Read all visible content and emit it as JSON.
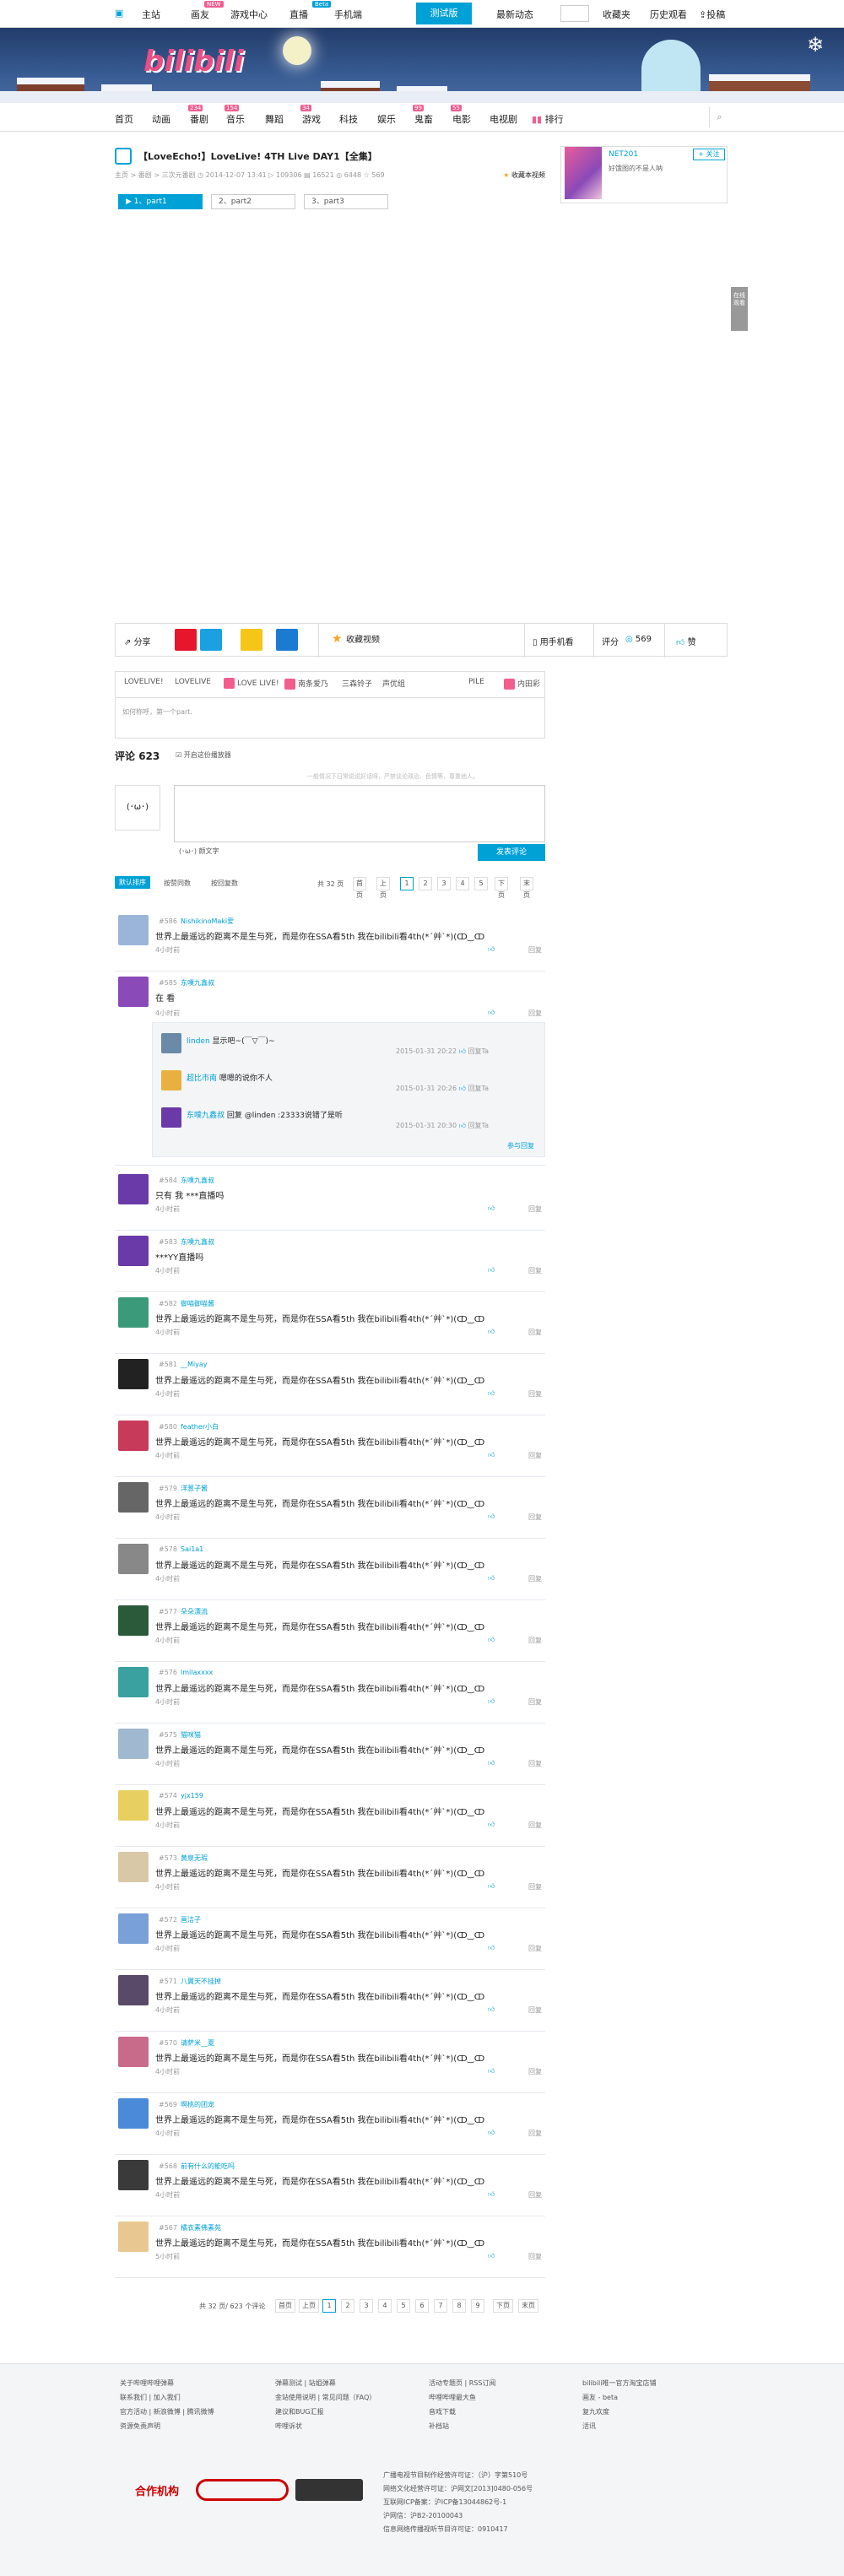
{
  "topbar": {
    "home": "主站",
    "circle": "画友",
    "circle_tag": "NEW",
    "game": "游戏中心",
    "live": "直播",
    "live_tag": "Beta",
    "mobile": "手机端",
    "beta": "测试版",
    "dynamic": "最新动态",
    "favorites": "收藏夹",
    "history": "历史观看",
    "upload": "投稿"
  },
  "nav": {
    "items": [
      {
        "label": "首页",
        "count": ""
      },
      {
        "label": "动画",
        "count": ""
      },
      {
        "label": "番剧",
        "count": "234"
      },
      {
        "label": "音乐",
        "count": "154"
      },
      {
        "label": "舞蹈",
        "count": ""
      },
      {
        "label": "游戏",
        "count": "34"
      },
      {
        "label": "科技",
        "count": ""
      },
      {
        "label": "娱乐",
        "count": ""
      },
      {
        "label": "鬼畜",
        "count": "99"
      },
      {
        "label": "电影",
        "count": "55"
      },
      {
        "label": "电视剧",
        "count": ""
      },
      {
        "label": "排行",
        "count": ""
      }
    ]
  },
  "video": {
    "title": "【LoveEcho!】LoveLive! 4TH Live DAY1【全集】",
    "breadcrumb": "主页 > 番剧 > 三次元番剧",
    "date": "2014-12-07 13:41",
    "plays": "109306",
    "danmaku": "16521",
    "coins": "6448",
    "favs": "569",
    "fav_label": "收藏本视频",
    "parts": [
      "1、part1",
      "2、part2",
      "3、part3"
    ]
  },
  "uploader": {
    "name": "NET201",
    "sign": "好饿图的不是人呐",
    "follow": "+ 关注"
  },
  "side_float": "在线观看",
  "actions": {
    "share": "分享",
    "collect": "收藏视频",
    "mobile": "用手机看",
    "score_label": "评分",
    "score": "569",
    "like": "赞"
  },
  "tags": [
    "LOVELIVE!",
    "LOVELIVE",
    "LOVE LIVE!",
    "南条爱乃",
    "三森铃子",
    "声优组",
    "PILE",
    "内田彩"
  ],
  "tag_hint": "如何称呼，第一个part.",
  "comments_header": {
    "title": "评论",
    "count": "623",
    "toggle": "开启这份播放器",
    "ad": "一般情况下日常说说好话呀，严禁谈论政治、色情等，尊重他人。"
  },
  "editor": {
    "avatar": "(･ω･)",
    "emoji": "(･ω･) 颜文字",
    "send": "发表评论"
  },
  "sort": {
    "default": "默认排序",
    "by_likes": "按赞同数",
    "by_replies": "按回复数",
    "total_pages": "共 32 页",
    "first": "首页",
    "prev": "上页",
    "pages": [
      "1",
      "2",
      "3",
      "4",
      "5"
    ],
    "next": "下页",
    "last": "末页"
  },
  "comments": [
    {
      "floor": "#586",
      "user": "NishikinoMaki爱",
      "text": "世界上最遥远的距离不是生与死，而是你在SSA看5th 我在bilibili看4th(*´艸`*)(ↀ‿ↀ",
      "time": "4小时前",
      "likes": "",
      "color": "#9bb5d8"
    },
    {
      "floor": "#585",
      "user": "东噗九鑫叔",
      "text": "在 看",
      "time": "4小时前",
      "likes": "",
      "color": "#8a4ab8"
    },
    {
      "floor": "#584",
      "user": "东噗九鑫叔",
      "text": "只有 我 ***直播吗",
      "time": "4小时前",
      "likes": "",
      "color": "#6a3aa8"
    },
    {
      "floor": "#583",
      "user": "东噗九鑫叔",
      "text": "***YY直播吗",
      "time": "4小时前",
      "likes": "",
      "color": "#6a3aa8"
    },
    {
      "floor": "#582",
      "user": "御喵御喵酱",
      "text": "世界上最遥远的距离不是生与死，而是你在SSA看5th 我在bilibili看4th(*´艸`*)(ↀ‿ↀ",
      "time": "4小时前",
      "likes": "",
      "color": "#3a9a7a"
    },
    {
      "floor": "#581",
      "user": "__Miyay",
      "text": "世界上最遥远的距离不是生与死，而是你在SSA看5th 我在bilibili看4th(*´艸`*)(ↀ‿ↀ",
      "time": "4小时前",
      "likes": "",
      "color": "#222"
    },
    {
      "floor": "#580",
      "user": "feather小白",
      "text": "世界上最遥远的距离不是生与死，而是你在SSA看5th 我在bilibili看4th(*´艸`*)(ↀ‿ↀ",
      "time": "4小时前",
      "likes": "",
      "color": "#c83a5a"
    },
    {
      "floor": "#579",
      "user": "洋葱子酱",
      "text": "世界上最遥远的距离不是生与死，而是你在SSA看5th 我在bilibili看4th(*´艸`*)(ↀ‿ↀ",
      "time": "4小时前",
      "likes": "",
      "color": "#666"
    },
    {
      "floor": "#578",
      "user": "Sai1a1",
      "text": "世界上最遥远的距离不是生与死，而是你在SSA看5th 我在bilibili看4th(*´艸`*)(ↀ‿ↀ",
      "time": "4小时前",
      "likes": "",
      "color": "#888"
    },
    {
      "floor": "#577",
      "user": "朵朵漂流",
      "text": "世界上最遥远的距离不是生与死，而是你在SSA看5th 我在bilibili看4th(*´艸`*)(ↀ‿ↀ",
      "time": "4小时前",
      "likes": "",
      "color": "#2a5a3a"
    },
    {
      "floor": "#576",
      "user": "lmilaxxxx",
      "text": "世界上最遥远的距离不是生与死，而是你在SSA看5th 我在bilibili看4th(*´艸`*)(ↀ‿ↀ",
      "time": "4小时前",
      "likes": "",
      "color": "#3aa0a0"
    },
    {
      "floor": "#575",
      "user": "猫咪猫",
      "text": "世界上最遥远的距离不是生与死，而是你在SSA看5th 我在bilibili看4th(*´艸`*)(ↀ‿ↀ",
      "time": "4小时前",
      "likes": "",
      "color": "#a0b8d0"
    },
    {
      "floor": "#574",
      "user": "yjx159",
      "text": "世界上最遥远的距离不是生与死，而是你在SSA看5th 我在bilibili看4th(*´艸`*)(ↀ‿ↀ",
      "time": "4小时前",
      "likes": "",
      "color": "#e8d060"
    },
    {
      "floor": "#573",
      "user": "黄泉无瑕",
      "text": "世界上最遥远的距离不是生与死，而是你在SSA看5th 我在bilibili看4th(*´艸`*)(ↀ‿ↀ",
      "time": "4小时前",
      "likes": "",
      "color": "#d8c8a8"
    },
    {
      "floor": "#572",
      "user": "画洁子",
      "text": "世界上最遥远的距离不是生与死，而是你在SSA看5th 我在bilibili看4th(*´艸`*)(ↀ‿ↀ",
      "time": "4小时前",
      "likes": "",
      "color": "#7aa0d8"
    },
    {
      "floor": "#571",
      "user": "八翼天不挂掉",
      "text": "世界上最遥远的距离不是生与死，而是你在SSA看5th 我在bilibili看4th(*´艸`*)(ↀ‿ↀ",
      "time": "4小时前",
      "likes": "",
      "color": "#5a4a6a"
    },
    {
      "floor": "#570",
      "user": "请萨米__夏",
      "text": "世界上最遥远的距离不是生与死，而是你在SSA看5th 我在bilibili看4th(*´艸`*)(ↀ‿ↀ",
      "time": "4小时前",
      "likes": "",
      "color": "#c86a8a"
    },
    {
      "floor": "#569",
      "user": "啊桃的团宠",
      "text": "世界上最遥远的距离不是生与死，而是你在SSA看5th 我在bilibili看4th(*´艸`*)(ↀ‿ↀ",
      "time": "4小时前",
      "likes": "",
      "color": "#4a8ad8"
    },
    {
      "floor": "#568",
      "user": "前有什么的能吃吗",
      "text": "世界上最遥远的距离不是生与死，而是你在SSA看5th 我在bilibili看4th(*´艸`*)(ↀ‿ↀ",
      "time": "4小时前",
      "likes": "",
      "color": "#3a3a3a"
    },
    {
      "floor": "#567",
      "user": "橘衣素佛素苑",
      "text": "世界上最遥远的距离不是生与死，而是你在SSA看5th 我在bilibili看4th(*´艸`*)(ↀ‿ↀ",
      "time": "5小时前",
      "likes": "",
      "color": "#e8c890"
    }
  ],
  "replies": [
    {
      "user": "linden",
      "text": "显示吧~(￣▽￣)~",
      "time": "2015-01-31 20:22",
      "color": "#6a8aa8"
    },
    {
      "user": "超比市南",
      "text": "嗯嗯的说你不人",
      "time": "2015-01-31 20:26",
      "color": "#e8b040"
    },
    {
      "user": "东噗九鑫叔",
      "text": "回复 @linden :23333说错了是听",
      "time": "2015-01-31 20:30",
      "color": "#6a3aa8"
    }
  ],
  "reply_more": "参与回复",
  "reply_btn": "回复",
  "reply_btn_small": "回复Ta",
  "bottom_pager": {
    "summary": "共 32 页/ 623 个评论",
    "first": "首页",
    "prev": "上页",
    "pages": [
      "1",
      "2",
      "3",
      "4",
      "5",
      "6",
      "7",
      "8",
      "9"
    ],
    "next": "下页",
    "last": "末页"
  },
  "footer": {
    "col1": [
      "关于哔哩哔哩弹幕",
      "联系我们 | 加入我们",
      "官方活动 | 新浪微博 | 腾讯微博",
      "资源免责声明"
    ],
    "col2": [
      "弹幕测试 | 站姐弹幕",
      "金站使用说明 | 常见问题（FAQ）",
      "建议和BUG汇报",
      "哔哩诉状"
    ],
    "col3": [
      "活动专题页 | RSS订阅",
      "哔哩哔哩最大鱼",
      "音戏下载",
      "补档站"
    ],
    "col4": [
      "bilibili唯一官方淘宝店铺",
      "画友 - beta",
      "复九欢度",
      "活讯"
    ],
    "partner": "合作机构",
    "licenses": [
      "广播电视节目制作经营许可证：（沪）字第510号",
      "网络文化经营许可证：沪网文[2013]0480-056号",
      "互联网ICP备案：沪ICP备13044862号-1",
      "沪网信：沪B2-20100043",
      "信息网络传播视听节目许可证：0910417"
    ]
  }
}
